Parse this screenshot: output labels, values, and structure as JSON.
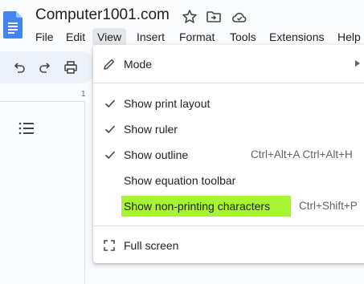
{
  "app": {
    "doc_title": "Computer1001.com",
    "doc_icon": "google-docs-icon",
    "title_icons": [
      "star-icon",
      "move-folder-icon",
      "cloud-saved-icon"
    ]
  },
  "menubar": {
    "items": [
      "File",
      "Edit",
      "View",
      "Insert",
      "Format",
      "Tools",
      "Extensions",
      "Help"
    ],
    "active": "View"
  },
  "toolbar": {
    "icons": [
      "undo-icon",
      "redo-icon",
      "print-icon"
    ]
  },
  "ruler": {
    "mark": "1"
  },
  "view_menu": {
    "items": [
      {
        "label": "Mode",
        "has_submenu": true,
        "icon": "pencil-icon"
      },
      {
        "label": "Show print layout",
        "checked": true
      },
      {
        "label": "Show ruler",
        "checked": true
      },
      {
        "label": "Show outline",
        "checked": true,
        "shortcut": "Ctrl+Alt+A Ctrl+Alt+H"
      },
      {
        "label": "Show equation toolbar",
        "checked": false
      },
      {
        "label": "Show non-printing characters",
        "checked": false,
        "shortcut": "Ctrl+Shift+P",
        "highlighted": true
      },
      {
        "label": "Full screen",
        "icon": "fullscreen-icon"
      }
    ],
    "highlight_color": "#a7f432"
  },
  "colors": {
    "docs_blue": "#4285f4",
    "menu_active_bg": "#e3e6ea",
    "toolbar_bg": "#edf2fa"
  }
}
